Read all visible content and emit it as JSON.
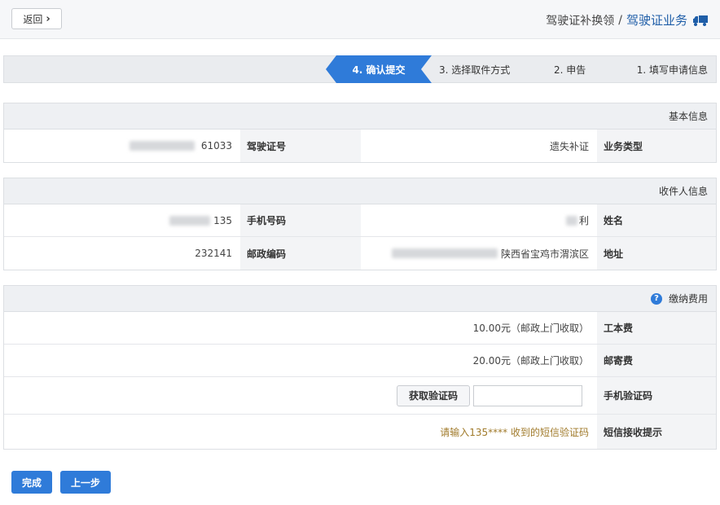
{
  "header": {
    "back_label": "返回",
    "breadcrumb_main": "驾驶证业务",
    "breadcrumb_sep": "/",
    "breadcrumb_sub": "驾驶证补换领"
  },
  "steps": [
    {
      "label": "1. 填写申请信息"
    },
    {
      "label": "2. 申告"
    },
    {
      "label": "3. 选择取件方式"
    },
    {
      "label": "4. 确认提交"
    }
  ],
  "basic_info": {
    "title": "基本信息",
    "business_type_label": "业务类型",
    "business_type_value": "遗失补证",
    "license_no_label": "驾驶证号",
    "license_no_value": "61033"
  },
  "recipient": {
    "title": "收件人信息",
    "name_label": "姓名",
    "name_value": "利",
    "phone_label": "手机号码",
    "phone_value": "135",
    "address_label": "地址",
    "address_value": "陕西省宝鸡市渭滨区",
    "postal_label": "邮政编码",
    "postal_value": "232141"
  },
  "fees": {
    "title": "缴纳费用",
    "cost_label": "工本费",
    "cost_value": "10.00元（邮政上门收取）",
    "post_label": "邮寄费",
    "post_value": "20.00元（邮政上门收取）",
    "code_label": "手机验证码",
    "code_button": "获取验证码",
    "sms_label": "短信接收提示",
    "sms_hint": "请输入135****     收到的短信验证码"
  },
  "footer": {
    "prev_label": "上一步",
    "done_label": "完成"
  }
}
